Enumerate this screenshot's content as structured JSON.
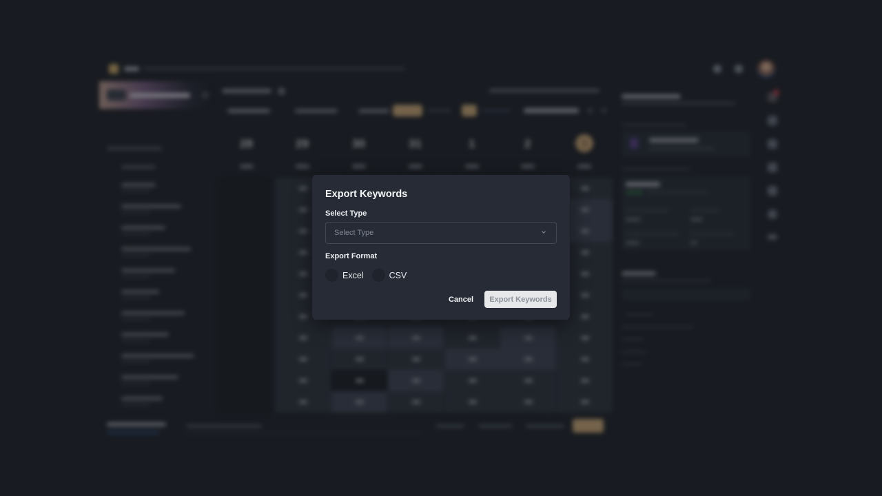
{
  "modal": {
    "title": "Export Keywords",
    "select_type_label": "Select Type",
    "select_type_placeholder": "Select Type",
    "select_type_value": "",
    "export_format_label": "Export Format",
    "formats": [
      {
        "label": "Excel",
        "selected": false
      },
      {
        "label": "CSV",
        "selected": false
      }
    ],
    "cancel_label": "Cancel",
    "export_label": "Export Keywords",
    "export_enabled": false
  },
  "background": {
    "blurred": true,
    "calendar": {
      "days": [
        "28",
        "29",
        "30",
        "31",
        "1",
        "2",
        "3"
      ],
      "today_index": 6
    },
    "keyword_rows": 11,
    "grid_values": [
      [
        "",
        "",
        "",
        "",
        "",
        "",
        ""
      ],
      [
        "",
        "",
        "",
        "",
        "",
        "",
        ""
      ]
    ],
    "colors": {
      "accent": "#d9b27c",
      "modal_bg": "#262b35",
      "page_bg": "#1b1e25",
      "grid_light": "#3d4454",
      "grid_mid": "#2c323d",
      "grid_dark": "#171a20"
    }
  }
}
